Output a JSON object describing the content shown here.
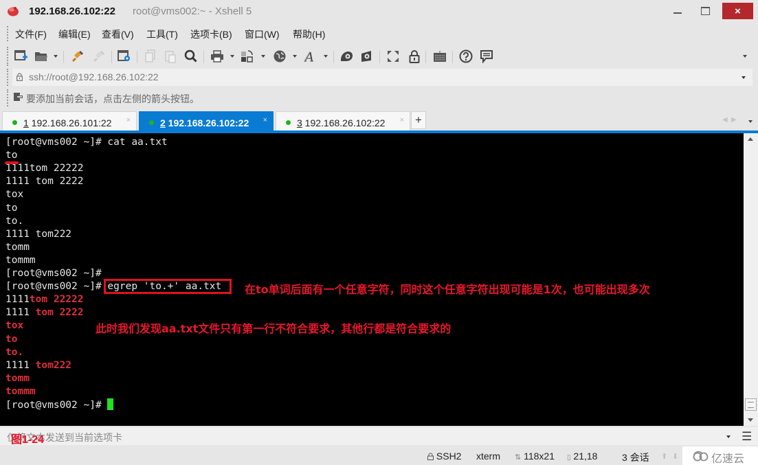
{
  "window": {
    "title_main": "192.168.26.102:22",
    "title_sub": "root@vms002:~ - Xshell 5",
    "close_label": "×",
    "app_icon": "xshell-logo-icon"
  },
  "menu": [
    {
      "label": "文件(F)"
    },
    {
      "label": "编辑(E)"
    },
    {
      "label": "查看(V)"
    },
    {
      "label": "工具(T)"
    },
    {
      "label": "选项卡(B)"
    },
    {
      "label": "窗口(W)"
    },
    {
      "label": "帮助(H)"
    }
  ],
  "toolbar": {
    "icons": [
      "new-session-icon",
      "open-folder-icon",
      "connect-icon",
      "disconnect-icon",
      "properties-icon",
      "copy-icon",
      "paste-icon",
      "find-icon",
      "print-icon",
      "transfer-icon",
      "globe-icon",
      "font-icon",
      "xftp-icon",
      "xmanager-icon",
      "fullscreen-icon",
      "lock-icon",
      "keyboard-icon",
      "help-icon",
      "chat-icon"
    ]
  },
  "address": {
    "value": "ssh://root@192.168.26.102:22"
  },
  "hint": {
    "text": "要添加当前会话，点击左侧的箭头按钮。"
  },
  "tabs": [
    {
      "num": "1",
      "label": " 192.168.26.101:22",
      "close": "×",
      "active": false,
      "status_color": "#1db41d"
    },
    {
      "num": "2",
      "label": " 192.168.26.102:22",
      "close": "×",
      "active": true,
      "status_color": "#1db41d"
    },
    {
      "num": "3",
      "label": " 192.168.26.102:22",
      "close": "×",
      "active": false,
      "status_color": "#1db41d"
    }
  ],
  "tab_add_label": "+",
  "terminal": {
    "lines": [
      {
        "prompt": "[root@vms002 ~]# ",
        "plain": "cat aa.txt",
        "match": "",
        "rest": ""
      },
      {
        "prompt": "",
        "plain": "to",
        "match": "",
        "rest": ""
      },
      {
        "prompt": "",
        "plain": "1111tom 22222",
        "match": "",
        "rest": ""
      },
      {
        "prompt": "",
        "plain": "1111 tom 2222",
        "match": "",
        "rest": ""
      },
      {
        "prompt": "",
        "plain": "tox",
        "match": "",
        "rest": ""
      },
      {
        "prompt": "",
        "plain": "to",
        "match": "",
        "rest": ""
      },
      {
        "prompt": "",
        "plain": "to.",
        "match": "",
        "rest": ""
      },
      {
        "prompt": "",
        "plain": "1111 tom222",
        "match": "",
        "rest": ""
      },
      {
        "prompt": "",
        "plain": "tomm",
        "match": "",
        "rest": ""
      },
      {
        "prompt": "",
        "plain": "tommm",
        "match": "",
        "rest": ""
      },
      {
        "prompt": "[root@vms002 ~]#",
        "plain": "",
        "match": "",
        "rest": ""
      },
      {
        "prompt": "[root@vms002 ~]# ",
        "plain": "egrep 'to.+' aa.txt",
        "match": "",
        "rest": ""
      },
      {
        "prompt": "",
        "plain": "1111",
        "match": "tom 22222",
        "rest": ""
      },
      {
        "prompt": "",
        "plain": "1111 ",
        "match": "tom 2222",
        "rest": ""
      },
      {
        "prompt": "",
        "plain": "",
        "match": "tox",
        "rest": ""
      },
      {
        "prompt": "",
        "plain": "",
        "match": "to",
        "rest": ""
      },
      {
        "prompt": "",
        "plain": "",
        "match": "to.",
        "rest": ""
      },
      {
        "prompt": "",
        "plain": "1111 ",
        "match": "tom222",
        "rest": ""
      },
      {
        "prompt": "",
        "plain": "",
        "match": "tomm",
        "rest": ""
      },
      {
        "prompt": "",
        "plain": "",
        "match": "tommm",
        "rest": ""
      },
      {
        "prompt": "[root@vms002 ~]# ",
        "plain": "",
        "match": "",
        "rest": ""
      }
    ],
    "highlight_color": "#e1303a",
    "cursor_color": "#1ee31e"
  },
  "annotations": {
    "note1": "在to单词后面有一个任意字符，同时这个任意字符出现可能是1次，也可能出现多次",
    "note2": "此时我们发现aa.txt文件只有第一行不符合要求，其他行都是符合要求的",
    "color": "#e8172b"
  },
  "compose": {
    "placeholder": "仅将文本发送到当前选项卡",
    "figure_label": "图1-24"
  },
  "status": {
    "protocol": "SSH2",
    "term": "xterm",
    "size": "118x21",
    "cursor_pos": "21,18",
    "sessions": "3 会话",
    "watermark": "亿速云"
  }
}
